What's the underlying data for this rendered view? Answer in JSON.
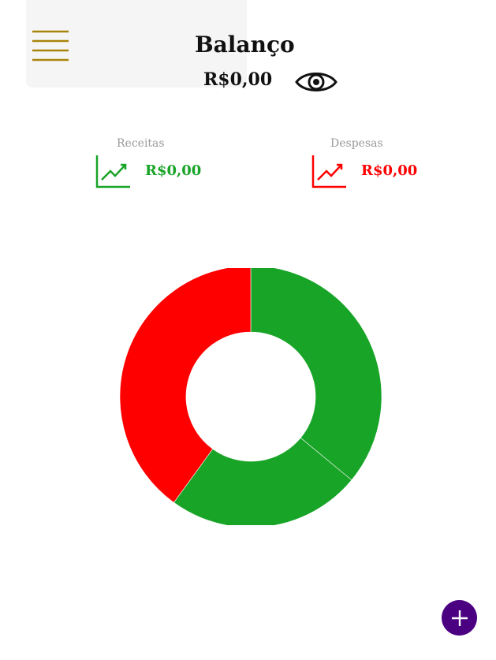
{
  "header": {
    "title": "Balanço",
    "balance": "R$0,00"
  },
  "summary": {
    "income": {
      "label": "Receitas",
      "value": "R$0,00",
      "color": "#18a427"
    },
    "expenses": {
      "label": "Despesas",
      "value": "R$0,00",
      "color": "#ff0000"
    }
  },
  "icons": {
    "menu": "hamburger-menu-icon",
    "visibility": "eye-icon",
    "income": "trending-up-icon",
    "expenses": "trending-up-icon",
    "add": "plus-icon"
  },
  "colors": {
    "menu": "#a8840c",
    "fab": "#4b0082",
    "header_card": "#f5f5f5"
  },
  "chart_data": {
    "type": "pie",
    "donut": true,
    "slices": [
      {
        "value": 36,
        "color": "#18a427"
      },
      {
        "value": 24,
        "color": "#18a427"
      },
      {
        "value": 40,
        "color": "#ff0000"
      }
    ]
  }
}
